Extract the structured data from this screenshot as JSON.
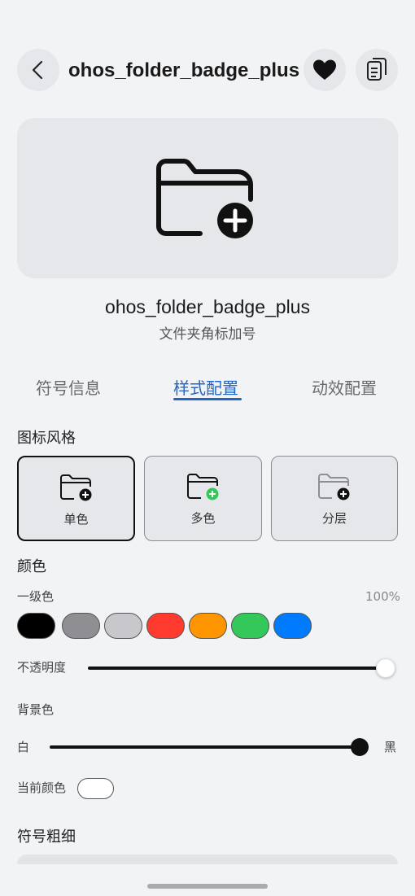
{
  "header": {
    "title": "ohos_folder_badge_plus",
    "back_icon": "chevron-left-icon",
    "favorite_icon": "heart-icon",
    "copy_icon": "copy-icon"
  },
  "symbol": {
    "name": "ohos_folder_badge_plus",
    "chinese_name": "文件夹角标加号"
  },
  "tabs": [
    {
      "label": "符号信息",
      "active": false
    },
    {
      "label": "样式配置",
      "active": true
    },
    {
      "label": "动效配置",
      "active": false
    }
  ],
  "icon_style": {
    "title": "图标风格",
    "options": [
      {
        "label": "单色",
        "selected": true
      },
      {
        "label": "多色",
        "selected": false
      },
      {
        "label": "分层",
        "selected": false
      }
    ]
  },
  "color": {
    "title": "颜色",
    "primary_label": "一级色",
    "primary_percent": "100%",
    "swatches": [
      "#000000",
      "#8e8e93",
      "#c7c7cc",
      "#ff3b30",
      "#ff9500",
      "#34c759",
      "#007aff"
    ]
  },
  "opacity": {
    "label": "不透明度",
    "value": 1.0
  },
  "background": {
    "title": "背景色",
    "left_label": "白",
    "right_label": "黑",
    "value": 0.98
  },
  "current_color": {
    "label": "当前颜色",
    "value": "#ffffff"
  },
  "weight": {
    "title": "符号粗细"
  },
  "accent_color": "#2466c8"
}
